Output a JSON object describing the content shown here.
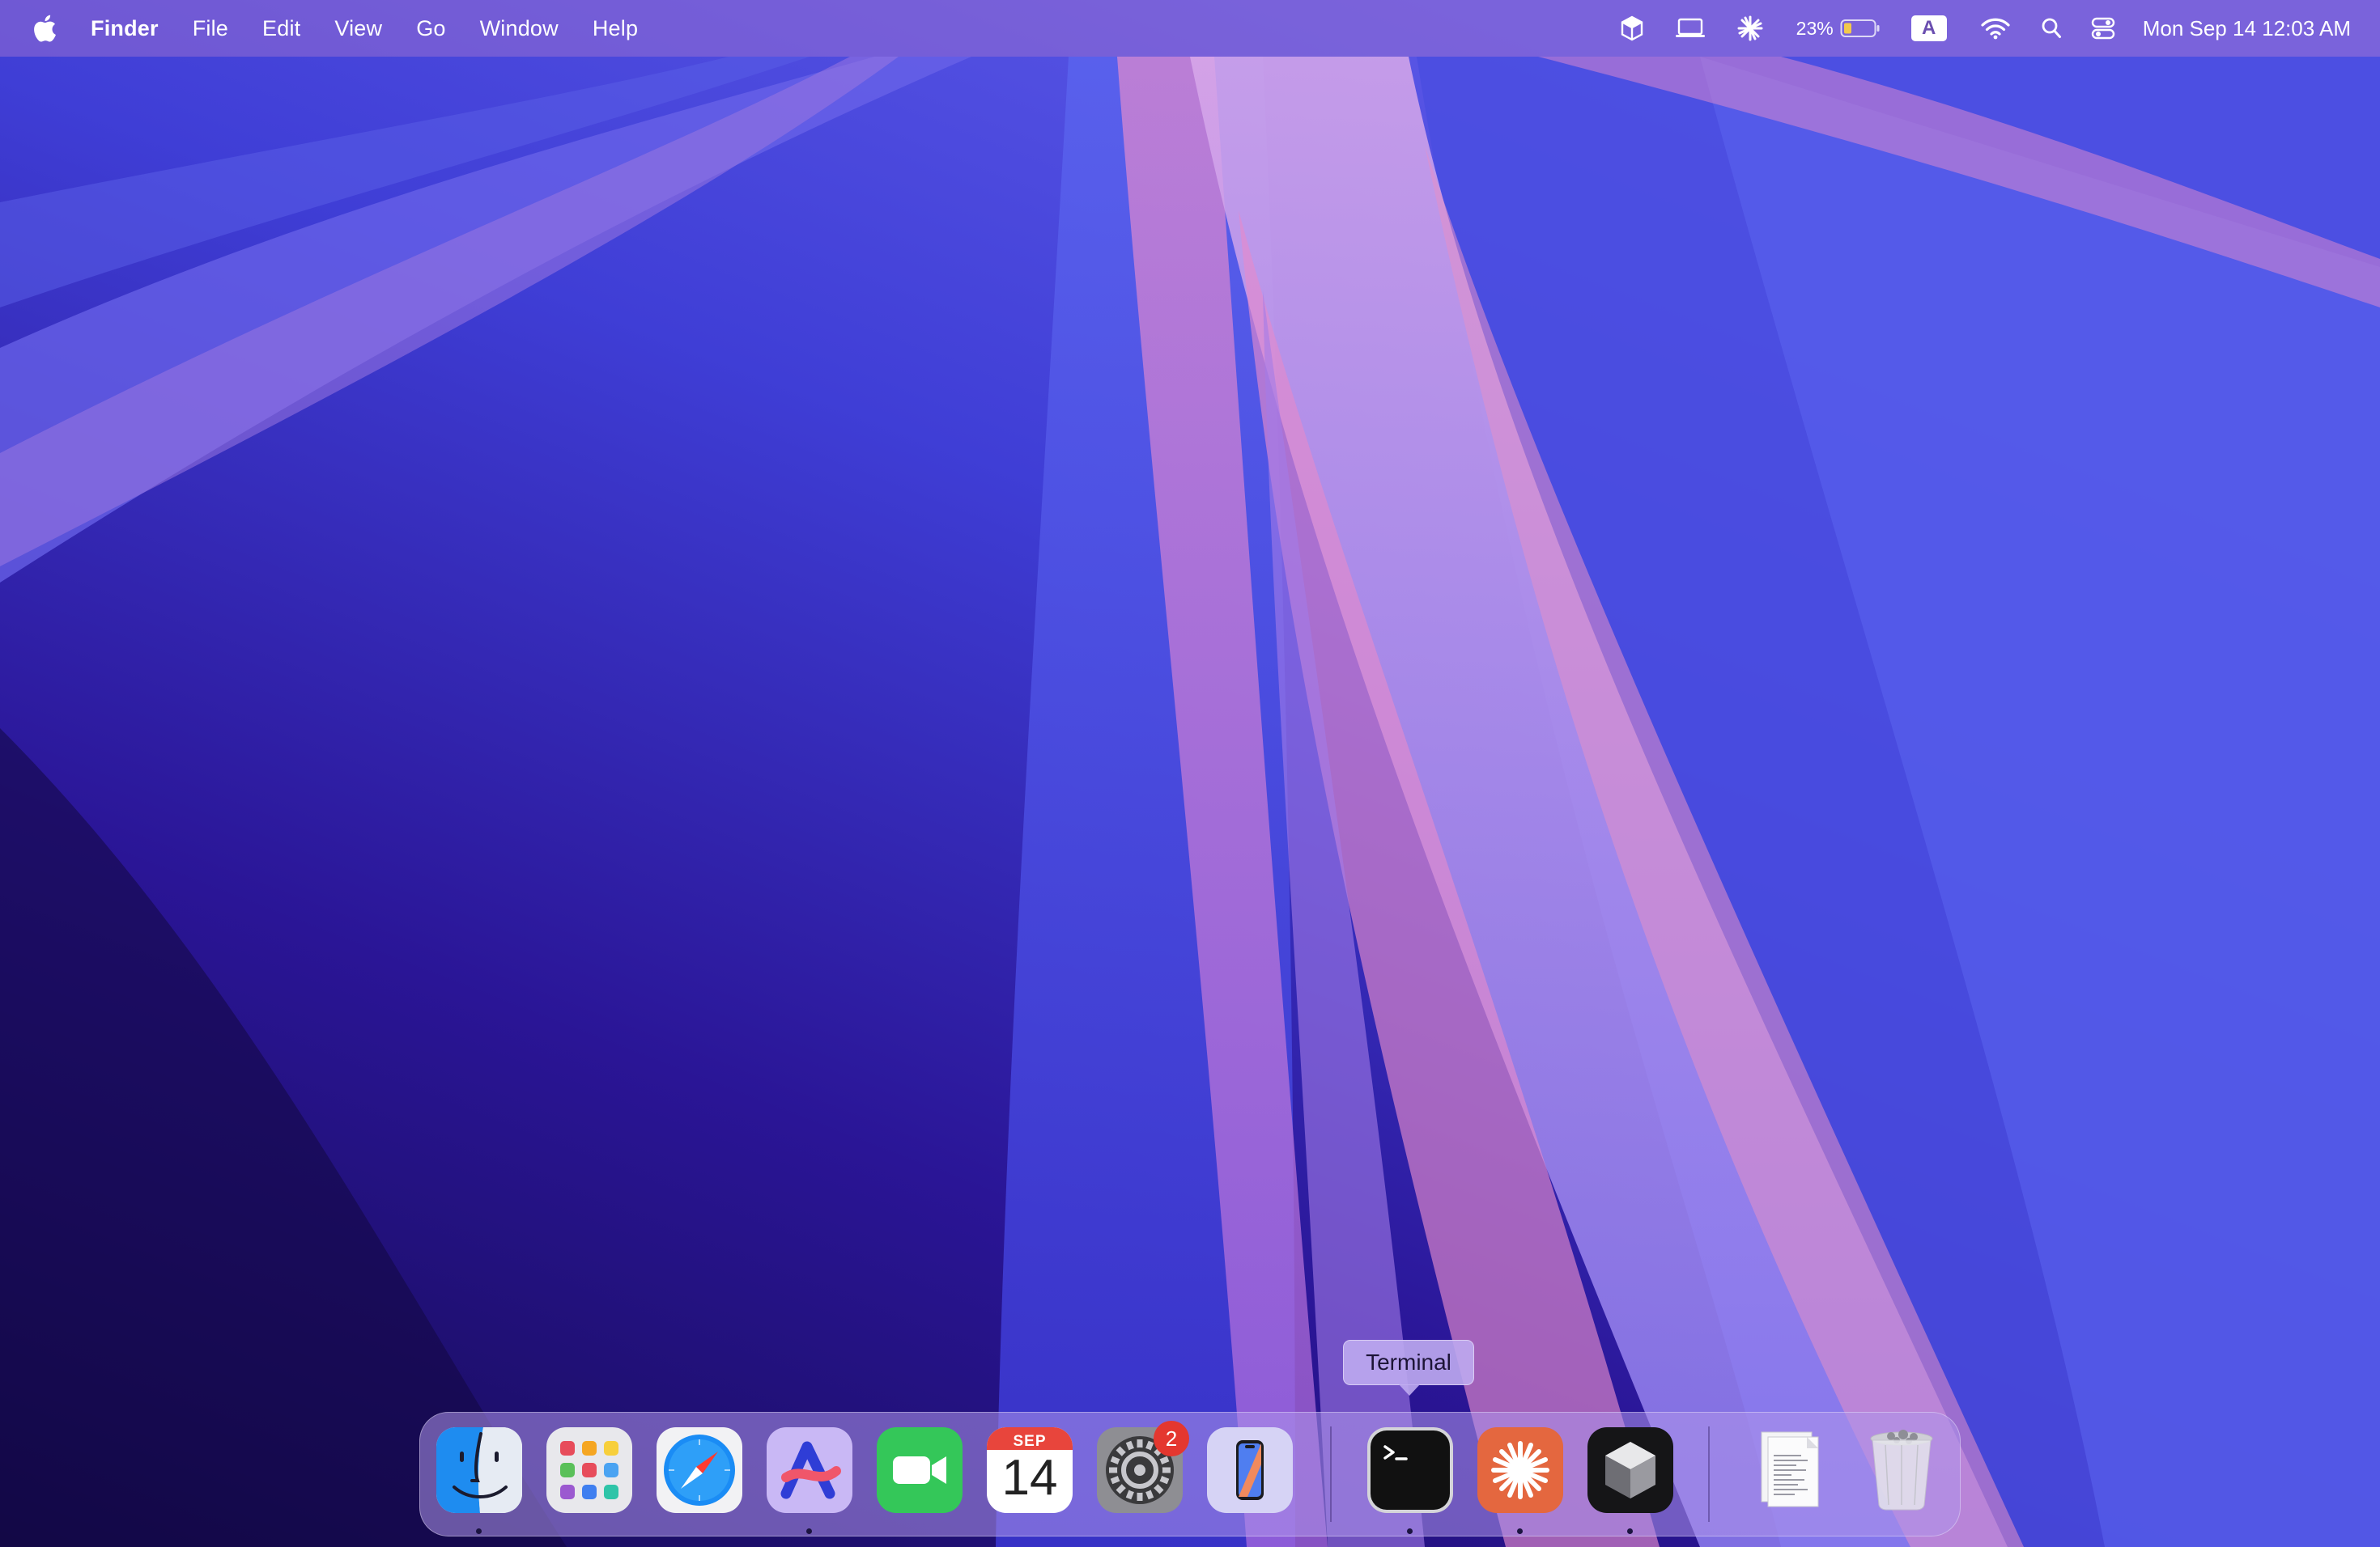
{
  "menubar": {
    "app_name": "Finder",
    "menus": [
      "File",
      "Edit",
      "View",
      "Go",
      "Window",
      "Help"
    ],
    "status": {
      "battery_percent": "23%",
      "input_source": "A",
      "clock": "Mon Sep 14  12:03 AM"
    }
  },
  "dock": {
    "tooltip": "Terminal",
    "calendar": {
      "month": "SEP",
      "day": "14"
    },
    "settings_badge": "2",
    "apps": [
      "finder-icon",
      "launchpad-icon",
      "safari-icon",
      "arc-icon",
      "facetime-icon",
      "calendar-icon",
      "system-settings-icon",
      "iphone-mirroring-icon",
      "terminal-icon",
      "claude-icon",
      "cube-app-icon",
      "documents-stack-icon",
      "trash-icon"
    ]
  },
  "colors": {
    "accent": "#e4372f",
    "wallpaper_base": "#2a1a8a",
    "terminal_bg": "#111111",
    "claude_bg": "#e4673f"
  }
}
